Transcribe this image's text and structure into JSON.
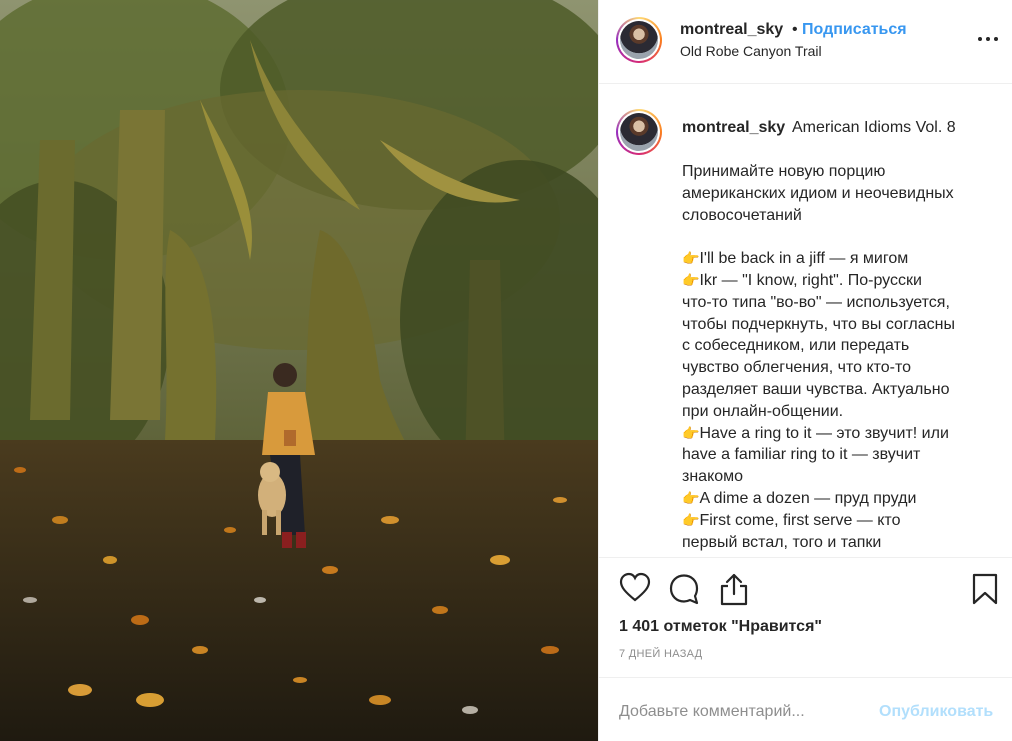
{
  "post": {
    "photo_name": "forest-photo"
  },
  "header": {
    "username": "montreal_sky",
    "separator": "•",
    "follow_label": "Подписаться",
    "location": "Old Robe Canyon Trail",
    "more_icon": "more-options-icon"
  },
  "caption": {
    "username": "montreal_sky",
    "title": "American Idioms Vol. 8",
    "intro": [
      "Принимайте новую порцию",
      "американских идиом и неочевидных",
      "словосочетаний"
    ],
    "intro_emoji": "🙂",
    "bullet_emoji": "👉",
    "items": [
      {
        "lines": [
          "I'll be back in a jiff — я мигом"
        ]
      },
      {
        "lines": [
          "Ikr — \"I know, right\". По-русски",
          "что-то типа \"во-во\" — используется,",
          "чтобы подчеркнуть, что вы согласны",
          "с собеседником, или передать",
          "чувство облегчения, что кто-то",
          "разделяет ваши чувства. Актуально",
          "при онлайн-общении."
        ]
      },
      {
        "lines": [
          "Have a ring to it — это звучит! или",
          "have a familiar ring to it — звучит",
          "знакомо"
        ]
      },
      {
        "lines": [
          "A dime a dozen — пруд пруди"
        ]
      },
      {
        "lines": [
          "First come, first serve — кто",
          "первый встал, того и тапки"
        ]
      }
    ]
  },
  "actions": {
    "like_icon": "heart-icon",
    "comment_icon": "comment-icon",
    "share_icon": "share-icon",
    "save_icon": "bookmark-icon"
  },
  "likes_text": "1 401 отметок \"Нравится\"",
  "time_text": "7 ДНЕЙ НАЗАД",
  "comment": {
    "placeholder": "Добавьте комментарий...",
    "post_label": "Опубликовать"
  },
  "colors": {
    "accent": "#3897f0",
    "post_disabled": "#b2dffc",
    "muted": "#8e8e8e",
    "text": "#262626"
  }
}
